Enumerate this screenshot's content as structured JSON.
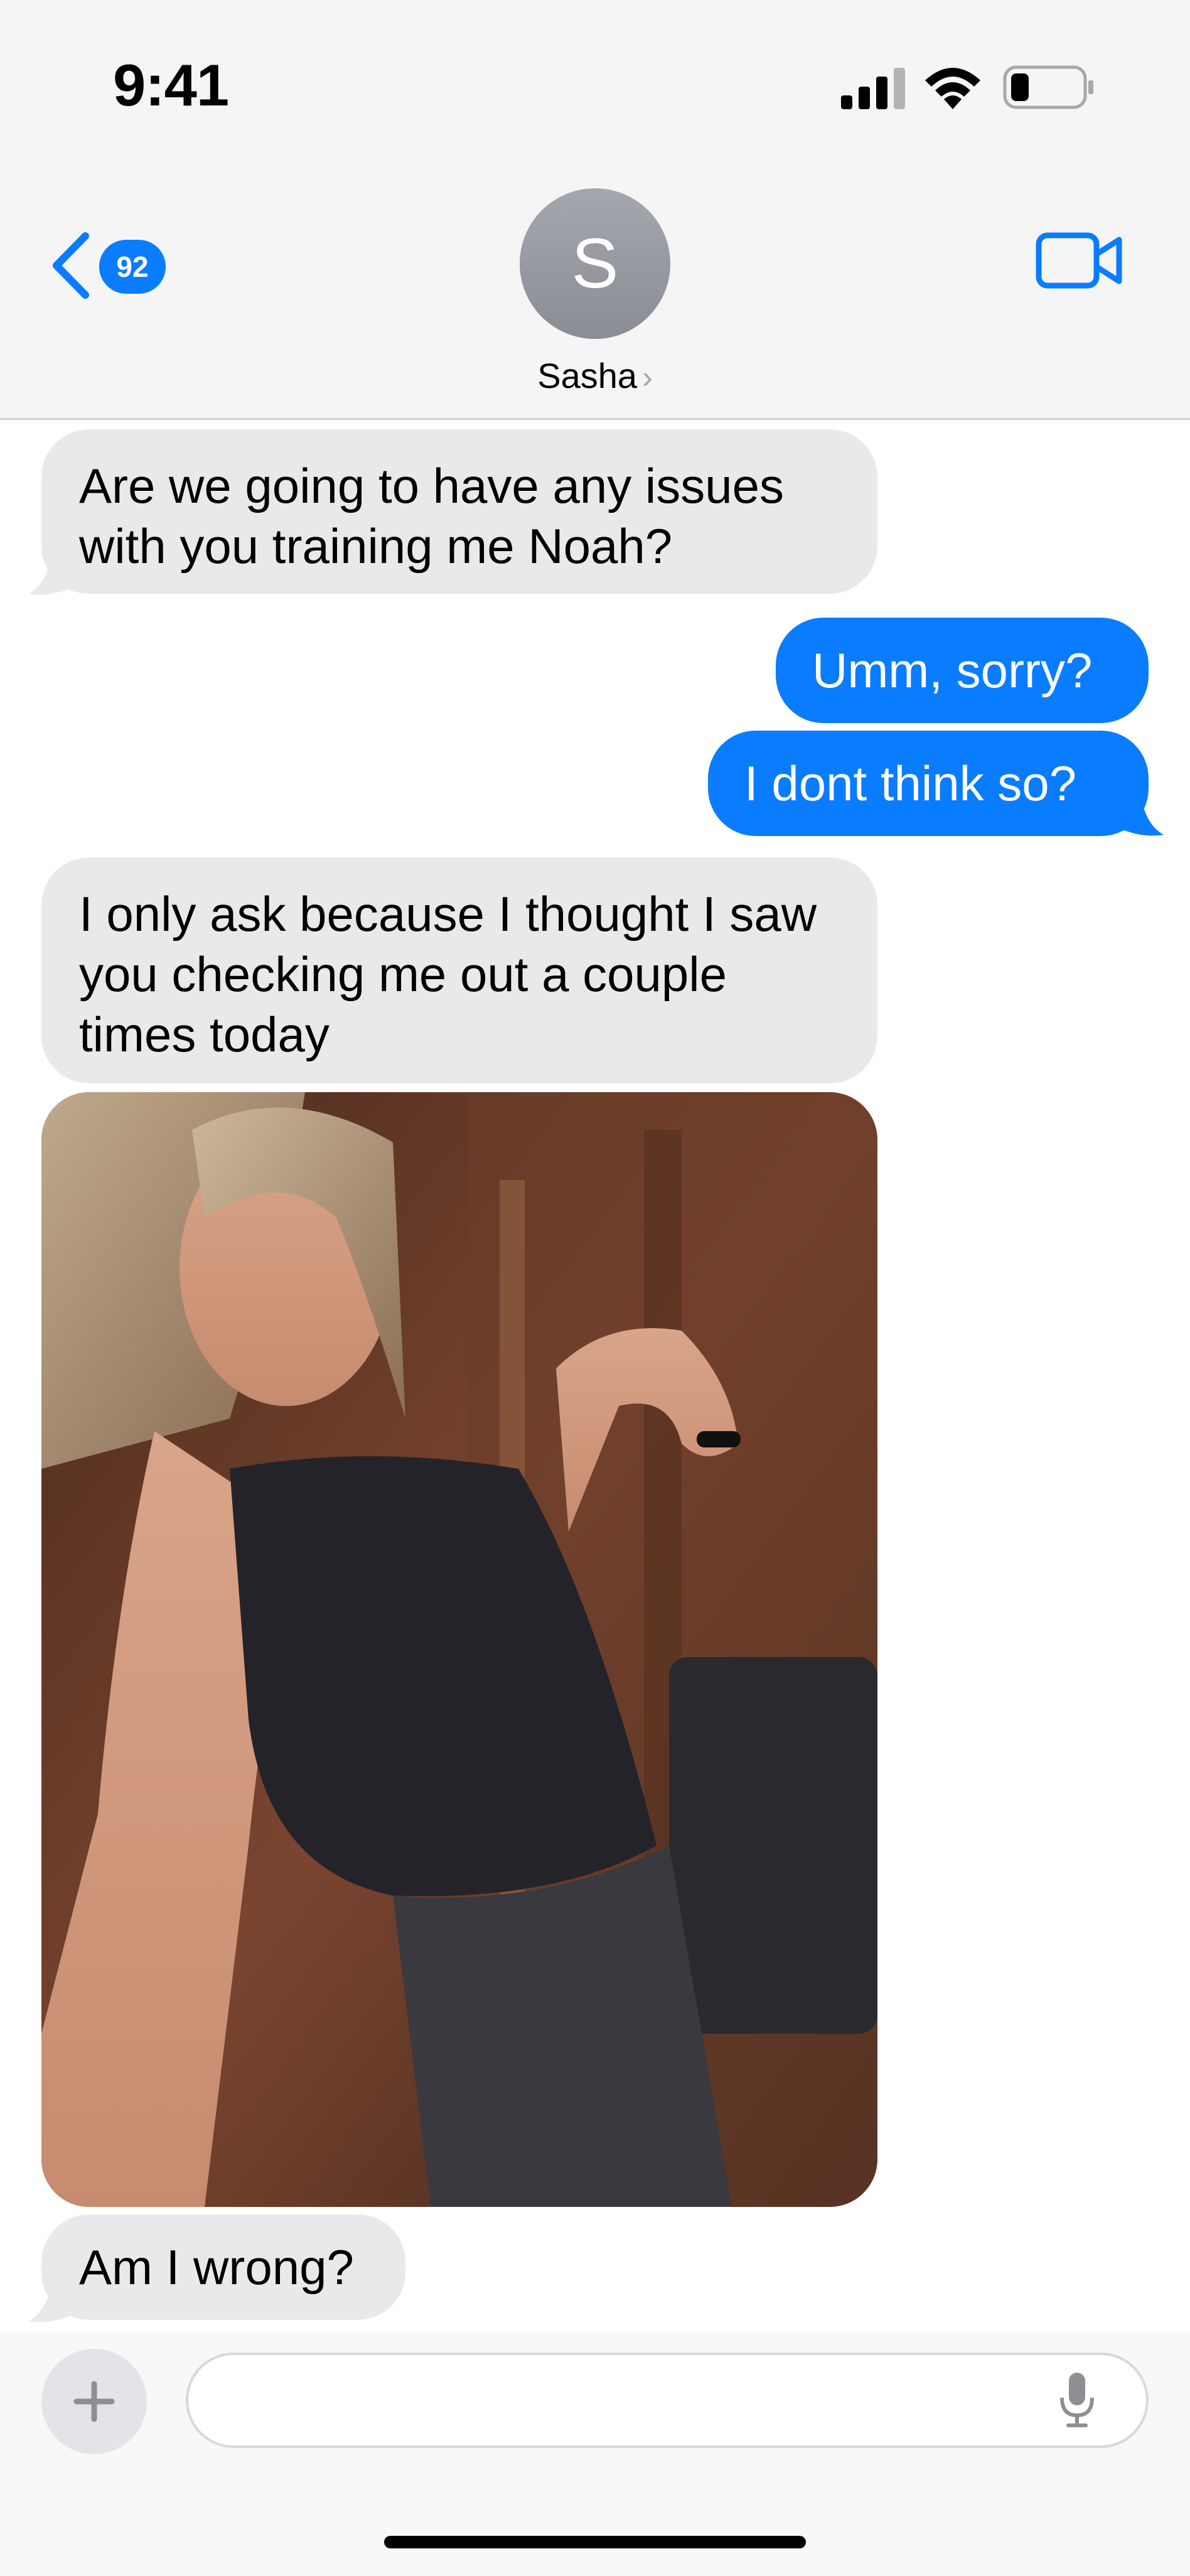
{
  "status_bar": {
    "time": "9:41",
    "signal_icon": "cellular-signal-icon",
    "wifi_icon": "wifi-icon",
    "battery_icon": "battery-icon"
  },
  "header": {
    "back_icon": "chevron-left-icon",
    "unread_count": "92",
    "avatar_initial": "S",
    "contact_name": "Sasha",
    "contact_chevron": "›",
    "video_icon": "video-camera-icon"
  },
  "messages": [
    {
      "from": "contact",
      "text": "Are we going to have any issues with you training me Noah?"
    },
    {
      "from": "me",
      "text": "Umm, sorry?"
    },
    {
      "from": "me",
      "text": "I dont think so?"
    },
    {
      "from": "contact",
      "text": "I only ask because I thought I saw you checking me out a couple times today"
    },
    {
      "from": "contact",
      "type": "image"
    },
    {
      "from": "contact",
      "text": "Am I wrong?"
    }
  ],
  "composer": {
    "plus_icon": "plus-icon",
    "placeholder": "",
    "mic_icon": "microphone-icon"
  },
  "colors": {
    "accent": "#0a7cff",
    "received_bubble": "#e9e9eb",
    "header_bg": "#f5f5f5"
  }
}
